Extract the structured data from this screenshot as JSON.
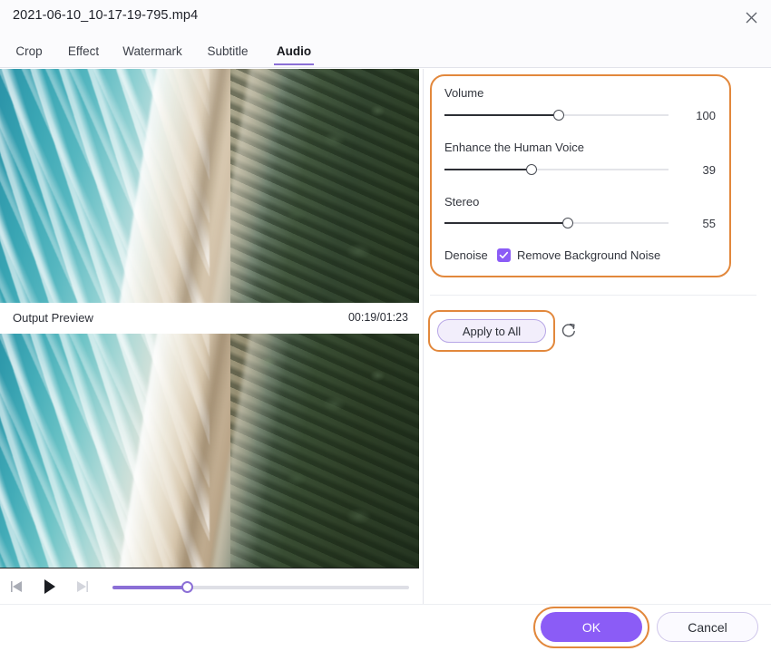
{
  "window": {
    "title": "2021-06-10_10-17-19-795.mp4",
    "close_icon": "close-icon"
  },
  "tabs": [
    {
      "label": "Crop",
      "active": false
    },
    {
      "label": "Effect",
      "active": false
    },
    {
      "label": "Watermark",
      "active": false
    },
    {
      "label": "Subtitle",
      "active": false
    },
    {
      "label": "Audio",
      "active": true
    }
  ],
  "preview": {
    "output_label": "Output Preview",
    "time": "00:19/01:23",
    "current_time": "00:19",
    "total_time": "01:23",
    "progress_percent": 25
  },
  "transport": {
    "prev_frame_icon": "previous-frame-icon",
    "play_icon": "play-icon",
    "next_frame_icon": "next-frame-icon"
  },
  "audio": {
    "sliders": [
      {
        "label": "Volume",
        "value": "100",
        "percent": 51
      },
      {
        "label": "Enhance the Human Voice",
        "value": "39",
        "percent": 39
      },
      {
        "label": "Stereo",
        "value": "55",
        "percent": 55
      }
    ],
    "denoise_label": "Denoise",
    "denoise_checkbox_label": "Remove Background Noise",
    "denoise_checked": true,
    "check_icon": "check-icon"
  },
  "actions": {
    "apply_to_all": "Apply to All",
    "reset_icon": "reset-icon",
    "ok": "OK",
    "cancel": "Cancel"
  },
  "colors": {
    "accent_purple": "#8b5cf6",
    "slider_purple": "#8b6fd6",
    "highlight_orange": "#e2883c",
    "apply_fill": "#f2eefb"
  }
}
